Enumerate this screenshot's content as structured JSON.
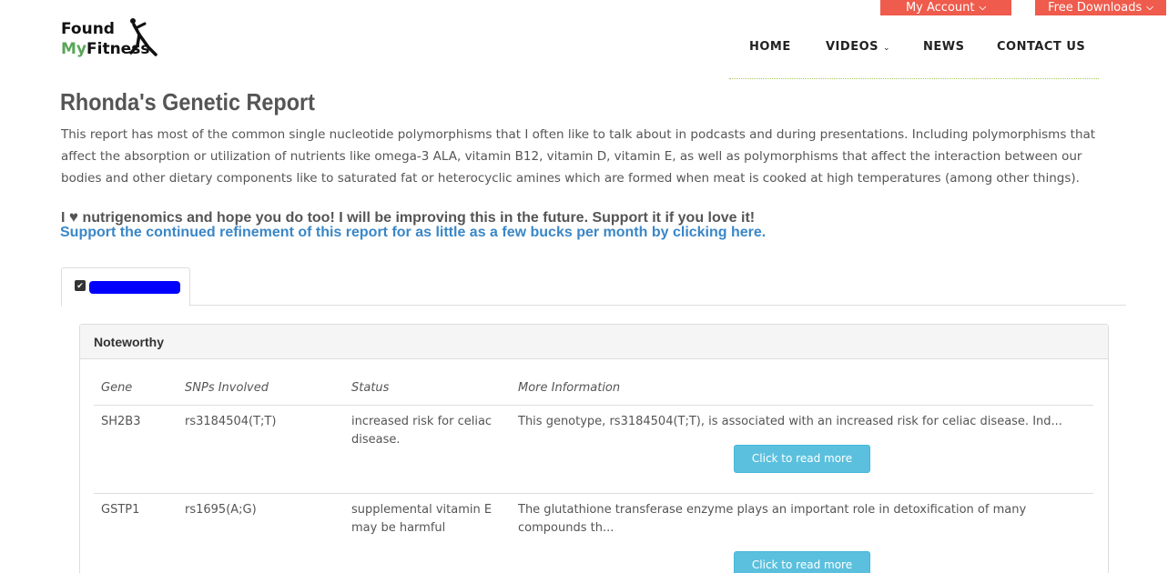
{
  "header": {
    "account_label": "My Account",
    "downloads_label": "Free Downloads",
    "logo_line1": "Found",
    "logo_line2_a": "My",
    "logo_line2_b": "Fitness"
  },
  "nav": {
    "home": "HOME",
    "videos": "VIDEOS",
    "news": "NEWS",
    "contact": "CONTACT US"
  },
  "main": {
    "title": "Rhonda's Genetic Report",
    "intro": "This report has most of the common single nucleotide polymorphisms that I often like to talk about in podcasts and during presentations. Including polymorphisms that affect the absorption or utilization of nutrients like omega-3 ALA, vitamin B12, vitamin D, vitamin E, as well as polymorphisms that affect the interaction between our bodies and other dietary components like to saturated fat or heterocyclic amines which are formed when meat is cooked at high temperatures (among other things).",
    "love_prefix": "I",
    "love_text": "nutrigenomics and hope you do too! I will be improving this in the future. Support it if you love it!",
    "support_link": "Support the continued refinement of this report for as little as a few bucks per month by clicking here."
  },
  "panel": {
    "heading": "Noteworthy",
    "columns": [
      "Gene",
      "SNPs Involved",
      "Status",
      "More Information"
    ],
    "rows": [
      {
        "gene": "SH2B3",
        "snp": "rs3184504(T;T)",
        "status": "increased risk for celiac disease.",
        "info": "This genotype, rs3184504(T;T), is associated with an increased risk for celiac disease. Ind...",
        "button": "Click to read more"
      },
      {
        "gene": "GSTP1",
        "snp": "rs1695(A;G)",
        "status": "supplemental vitamin E may be harmful",
        "info": "The glutathione transferase enzyme plays an important role in detoxification of many compounds th...",
        "button": "Click to read more"
      }
    ]
  },
  "colors": {
    "utility_buttons": "#ef5b4c",
    "link": "#3a87c7",
    "info_button": "#5bc0de",
    "logo_green": "#5aa55a"
  }
}
